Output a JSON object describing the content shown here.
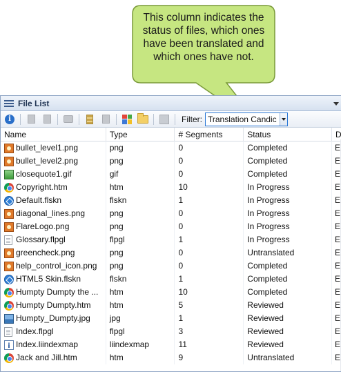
{
  "callout": {
    "text": "This column indicates the status of files, which ones have been translated and which ones have not.",
    "fill": "#c6e681",
    "stroke": "#7a9a3a"
  },
  "window": {
    "title": "File List"
  },
  "toolbar": {
    "filter_label": "Filter:",
    "filter_value": "Translation Candic"
  },
  "columns": [
    "Name",
    "Type",
    "# Segments",
    "Status",
    "Di"
  ],
  "rows": [
    {
      "name": "bullet_level1.png",
      "type": "png",
      "segments": "0",
      "status": "Completed",
      "d": "Ec",
      "icon": "png-icon"
    },
    {
      "name": "bullet_level2.png",
      "type": "png",
      "segments": "0",
      "status": "Completed",
      "d": "Ec",
      "icon": "png-icon"
    },
    {
      "name": "closequote1.gif",
      "type": "gif",
      "segments": "0",
      "status": "Completed",
      "d": "Ec",
      "icon": "gif-icon"
    },
    {
      "name": "Copyright.htm",
      "type": "htm",
      "segments": "10",
      "status": "In Progress",
      "d": "Ec",
      "icon": "htm-icon"
    },
    {
      "name": "Default.flskn",
      "type": "flskn",
      "segments": "1",
      "status": "In Progress",
      "d": "Ec",
      "icon": "skin-icon"
    },
    {
      "name": "diagonal_lines.png",
      "type": "png",
      "segments": "0",
      "status": "In Progress",
      "d": "Ec",
      "icon": "png-icon"
    },
    {
      "name": "FlareLogo.png",
      "type": "png",
      "segments": "0",
      "status": "In Progress",
      "d": "Ec",
      "icon": "png-icon"
    },
    {
      "name": "Glossary.flpgl",
      "type": "flpgl",
      "segments": "1",
      "status": "In Progress",
      "d": "Ec",
      "icon": "document-icon"
    },
    {
      "name": "greencheck.png",
      "type": "png",
      "segments": "0",
      "status": "Untranslated",
      "d": "Ec",
      "icon": "png-icon"
    },
    {
      "name": "help_control_icon.png",
      "type": "png",
      "segments": "0",
      "status": "Completed",
      "d": "Ec",
      "icon": "png-icon"
    },
    {
      "name": "HTML5 Skin.flskn",
      "type": "flskn",
      "segments": "1",
      "status": "Completed",
      "d": "Ec",
      "icon": "skin-icon"
    },
    {
      "name": "Humpty Dumpty the ...",
      "type": "htm",
      "segments": "10",
      "status": "Completed",
      "d": "Ec",
      "icon": "htm-icon"
    },
    {
      "name": "Humpty Dumpty.htm",
      "type": "htm",
      "segments": "5",
      "status": "Reviewed",
      "d": "Ec",
      "icon": "htm-icon"
    },
    {
      "name": "Humpty_Dumpty.jpg",
      "type": "jpg",
      "segments": "1",
      "status": "Reviewed",
      "d": "Ec",
      "icon": "jpg-icon"
    },
    {
      "name": "Index.flpgl",
      "type": "flpgl",
      "segments": "3",
      "status": "Reviewed",
      "d": "Ec",
      "icon": "document-icon"
    },
    {
      "name": "Index.liindexmap",
      "type": "liindexmap",
      "segments": "11",
      "status": "Reviewed",
      "d": "Ec",
      "icon": "index-icon"
    },
    {
      "name": "Jack and Jill.htm",
      "type": "htm",
      "segments": "9",
      "status": "Untranslated",
      "d": "Ec",
      "icon": "htm-icon"
    }
  ]
}
